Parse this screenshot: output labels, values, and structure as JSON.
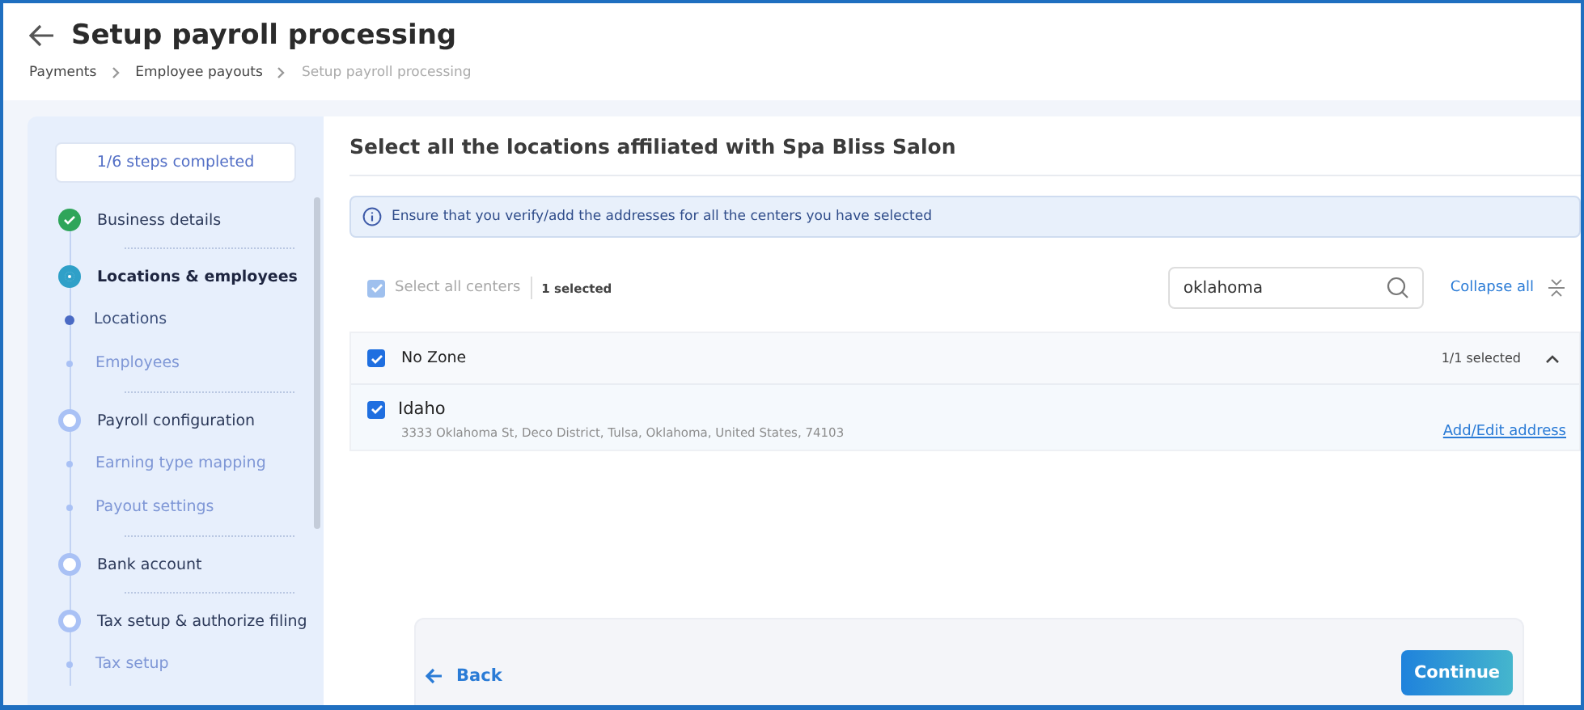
{
  "header": {
    "title": "Setup payroll processing",
    "breadcrumbs": [
      {
        "label": "Payments",
        "current": false
      },
      {
        "label": "Employee payouts",
        "current": false
      },
      {
        "label": "Setup payroll processing",
        "current": true
      }
    ]
  },
  "sidebar": {
    "progress": "1/6 steps completed",
    "steps": [
      {
        "kind": "step",
        "label": "Business details",
        "completed": true,
        "selected": false
      },
      {
        "kind": "divider"
      },
      {
        "kind": "step",
        "label": "Locations & employees",
        "completed": false,
        "selected": true
      },
      {
        "kind": "substep",
        "label": "Locations",
        "selected": true
      },
      {
        "kind": "substep",
        "label": "Employees",
        "selected": false
      },
      {
        "kind": "divider"
      },
      {
        "kind": "step",
        "label": "Payroll configuration",
        "completed": false,
        "selected": false
      },
      {
        "kind": "substep",
        "label": "Earning type mapping",
        "selected": false
      },
      {
        "kind": "substep",
        "label": "Payout settings",
        "selected": false
      },
      {
        "kind": "divider"
      },
      {
        "kind": "step",
        "label": "Bank account",
        "completed": false,
        "selected": false
      },
      {
        "kind": "divider"
      },
      {
        "kind": "step",
        "label": "Tax setup & authorize filing",
        "completed": false,
        "selected": false
      },
      {
        "kind": "substep",
        "label": "Tax setup",
        "selected": false
      }
    ]
  },
  "main": {
    "title": "Select all the locations affiliated with Spa Bliss Salon",
    "notice": "Ensure that you verify/add the addresses for all the centers you have selected",
    "select_all": {
      "label": "Select all centers",
      "checked": true,
      "disabled": true
    },
    "selected_count": "1 selected",
    "search": {
      "value": "oklahoma"
    },
    "collapse_all": "Collapse all",
    "zones": [
      {
        "name": "No Zone",
        "checked": true,
        "expanded": true,
        "count": "1/1 selected",
        "centers": [
          {
            "name": "Idaho",
            "checked": true,
            "address": "3333 Oklahoma St, Deco District, Tulsa, Oklahoma, United States, 74103",
            "action": "Add/Edit address"
          }
        ]
      }
    ]
  },
  "footer": {
    "back": "Back",
    "continue": "Continue"
  }
}
